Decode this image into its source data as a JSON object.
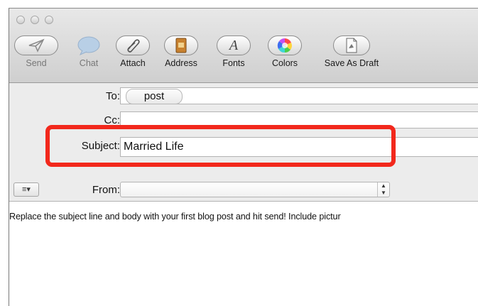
{
  "toolbar": {
    "items": [
      {
        "label": "Send",
        "icon": "send-icon",
        "enabled": false
      },
      {
        "label": "Chat",
        "icon": "chat-icon",
        "enabled": false
      },
      {
        "label": "Attach",
        "icon": "paperclip-icon",
        "enabled": true
      },
      {
        "label": "Address",
        "icon": "address-book-icon",
        "enabled": true
      },
      {
        "label": "Fonts",
        "icon": "fonts-icon",
        "enabled": true
      },
      {
        "label": "Colors",
        "icon": "color-wheel-icon",
        "enabled": true
      },
      {
        "label": "Save As Draft",
        "icon": "draft-document-icon",
        "enabled": true
      }
    ]
  },
  "fields": {
    "to_label": "To:",
    "to_recipient": "post",
    "cc_label": "Cc:",
    "cc_value": "",
    "subject_label": "Subject:",
    "subject_value": "Married Life",
    "from_label": "From:",
    "from_value": ""
  },
  "body": {
    "text": "Replace the subject line and body with your first blog post and hit send! Include pictur"
  },
  "colors": {
    "highlight": "#f2281c"
  }
}
